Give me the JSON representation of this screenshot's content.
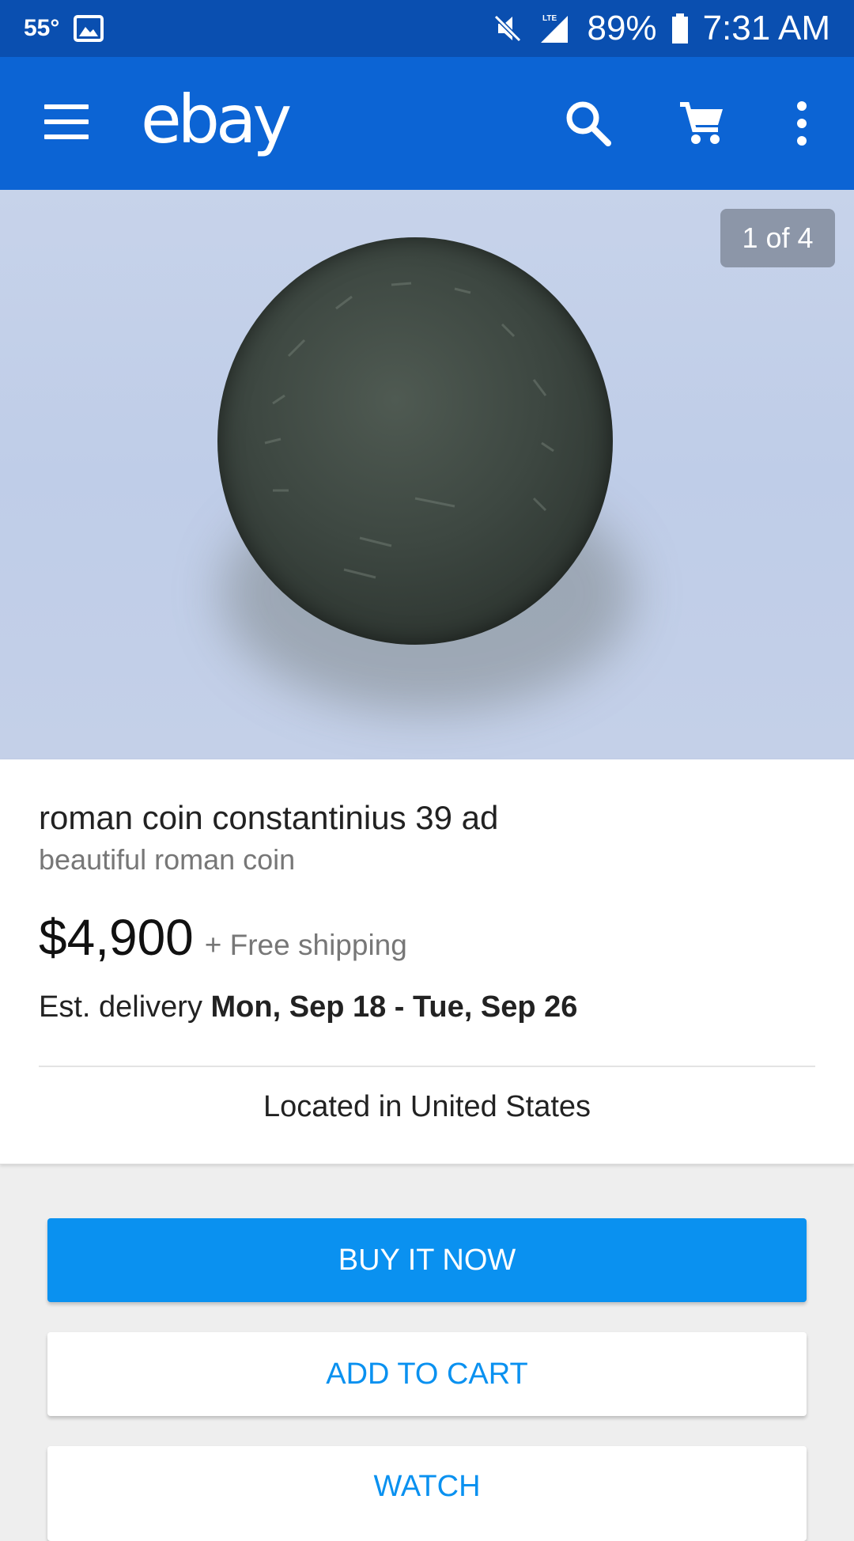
{
  "status_bar": {
    "temperature": "55°",
    "network": "LTE",
    "battery": "89%",
    "time": "7:31 AM"
  },
  "app_bar": {
    "logo": "ebay",
    "icons": [
      "menu-icon",
      "search-icon",
      "cart-icon",
      "more-vert-icon"
    ]
  },
  "image": {
    "counter": "1 of 4"
  },
  "listing": {
    "title": "roman coin constantinius 39 ad",
    "subtitle": "beautiful roman coin",
    "price": "$4,900",
    "shipping": "+ Free shipping",
    "delivery_label": "Est. delivery",
    "delivery_dates": "Mon, Sep 18 - Tue, Sep 26",
    "location": "Located in United States"
  },
  "actions": {
    "buy_now": "BUY IT NOW",
    "add_to_cart": "ADD TO CART",
    "watch": "WATCH"
  },
  "colors": {
    "status_bar": "#0a4fb0",
    "app_bar": "#0c64d4",
    "primary_button": "#0a91f0"
  }
}
